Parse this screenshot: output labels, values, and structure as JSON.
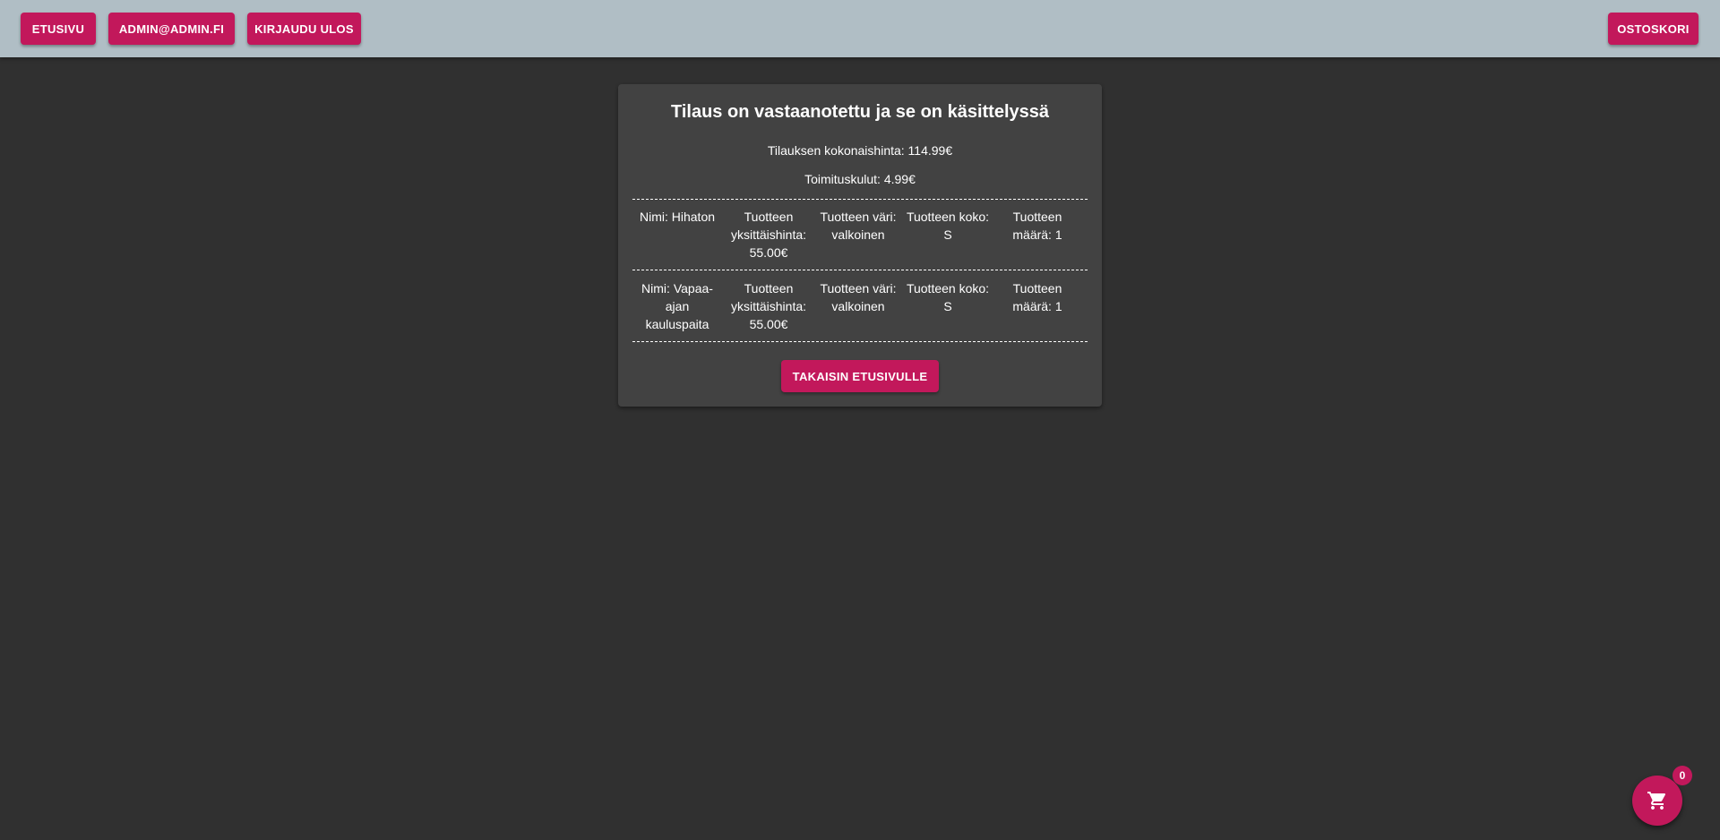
{
  "topbar": {
    "home_label": "ETUSIVU",
    "user_label": "ADMIN@ADMIN.FI",
    "logout_label": "KIRJAUDU ULOS",
    "cart_label": "OSTOSKORI"
  },
  "order": {
    "title": "Tilaus on vastaanotettu ja se on käsittelyssä",
    "total_text": "Tilauksen kokonaishinta: 114.99€",
    "shipping_text": "Toimituskulut: 4.99€",
    "items": [
      {
        "name": "Nimi: Hihaton",
        "unit_price": "Tuotteen yksittäishinta: 55.00€",
        "color": "Tuotteen väri: valkoinen",
        "size": "Tuotteen koko: S",
        "quantity": "Tuotteen määrä: 1"
      },
      {
        "name": "Nimi: Vapaa-ajan kauluspaita",
        "unit_price": "Tuotteen yksittäishinta: 55.00€",
        "color": "Tuotteen väri: valkoinen",
        "size": "Tuotteen koko: S",
        "quantity": "Tuotteen määrä: 1"
      }
    ],
    "back_label": "TAKAISIN ETUSIVULLE"
  },
  "fab": {
    "icon": "shopping-cart-icon",
    "badge_count": "0"
  },
  "colors": {
    "accent": "#c2185b",
    "topbar": "#b0bec5",
    "background": "#303030",
    "card": "#424242"
  }
}
